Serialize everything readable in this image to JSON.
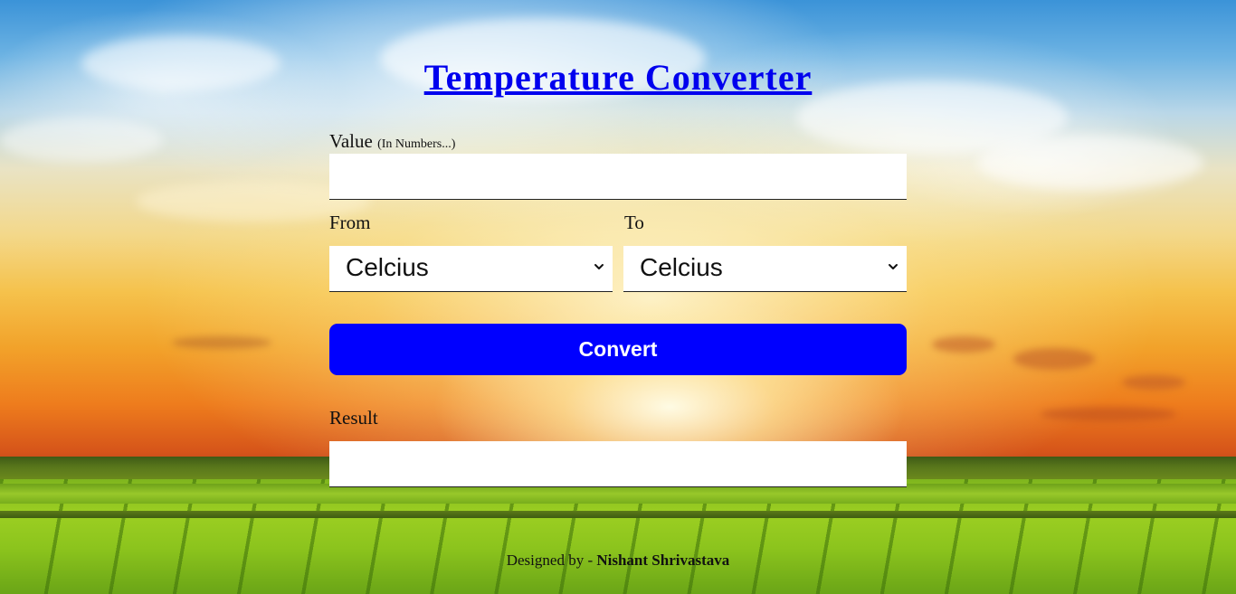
{
  "header": {
    "title": "Temperature Converter"
  },
  "form": {
    "value_label": "Value",
    "value_hint": "(In Numbers...)",
    "value_input": "",
    "from_label": "From",
    "from_selected": "Celcius",
    "to_label": "To",
    "to_selected": "Celcius",
    "convert_label": "Convert",
    "result_label": "Result",
    "result_value": ""
  },
  "footer": {
    "prefix": "Designed by - ",
    "author": "Nishant Shrivastava"
  },
  "colors": {
    "title_link": "#0000ee",
    "button_bg": "#0000ff",
    "button_text": "#ffffff"
  },
  "icons": {
    "select_arrow": "chevron-down-icon"
  }
}
